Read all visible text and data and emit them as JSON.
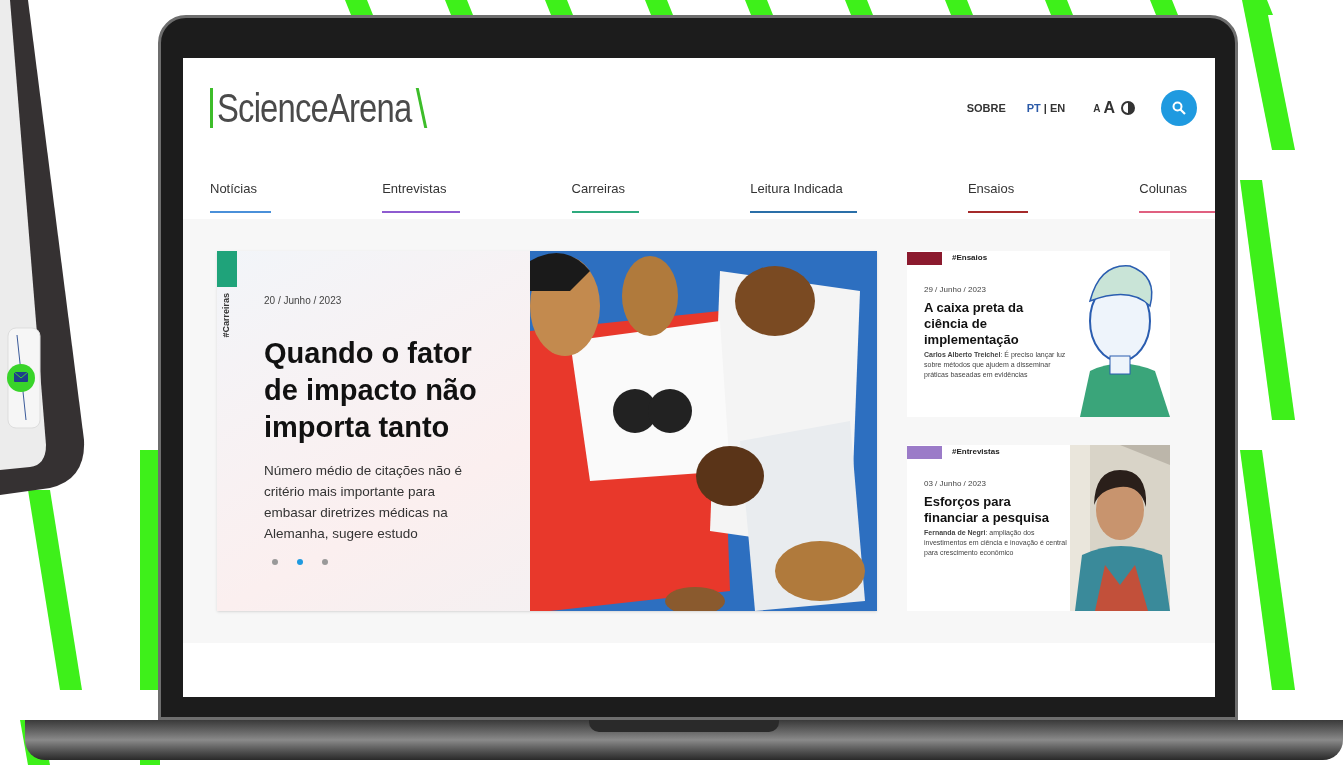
{
  "header": {
    "logo": "ScienceArena",
    "links": [
      "SOBRE"
    ],
    "languages": [
      {
        "label": "PT",
        "selected": true
      },
      {
        "label": "EN",
        "selected": false
      }
    ],
    "language_separator": "|",
    "font_sizes": [
      "A",
      "A"
    ]
  },
  "nav": [
    {
      "label": "Notícias",
      "color": "#4a90d9"
    },
    {
      "label": "Entrevistas",
      "color": "#8e5bd0"
    },
    {
      "label": "Carreiras",
      "color": "#2eaa7e"
    },
    {
      "label": "Leitura Indicada",
      "color": "#2a6fa8"
    },
    {
      "label": "Ensaios",
      "color": "#a52a2a"
    },
    {
      "label": "Colunas",
      "color": "#e06080"
    }
  ],
  "hero": {
    "tag": "#Carreiras",
    "color": "#1fa37a",
    "date": "20 / Junho / 2023",
    "title": "Quando o fator de impacto não importa tanto",
    "summary": "Número médio de citações não é critério mais importante para embasar diretrizes médicas na Alemanha, sugere estudo",
    "dots": [
      {
        "selected": false
      },
      {
        "selected": true
      },
      {
        "selected": false
      }
    ]
  },
  "cards": [
    {
      "tag": "#Ensaios",
      "color": "#8b1a2e",
      "date": "29 / Junho / 2023",
      "title": "A caixa preta da ciência de implementação",
      "author": "Carlos Alberto Treichel",
      "summary": ": É preciso lançar luz sobre métodos que ajudem a disseminar práticas baseadas em evidências",
      "kind": "drawing"
    },
    {
      "tag": "#Entrevistas",
      "color": "#9b7bc8",
      "date": "03 / Junho / 2023",
      "title": "Esforços para financiar a pesquisa",
      "author": "Fernanda de Negri",
      "summary": ": ampliação dos investimentos em ciência e inovação é central para crescimento econômico"
    }
  ]
}
